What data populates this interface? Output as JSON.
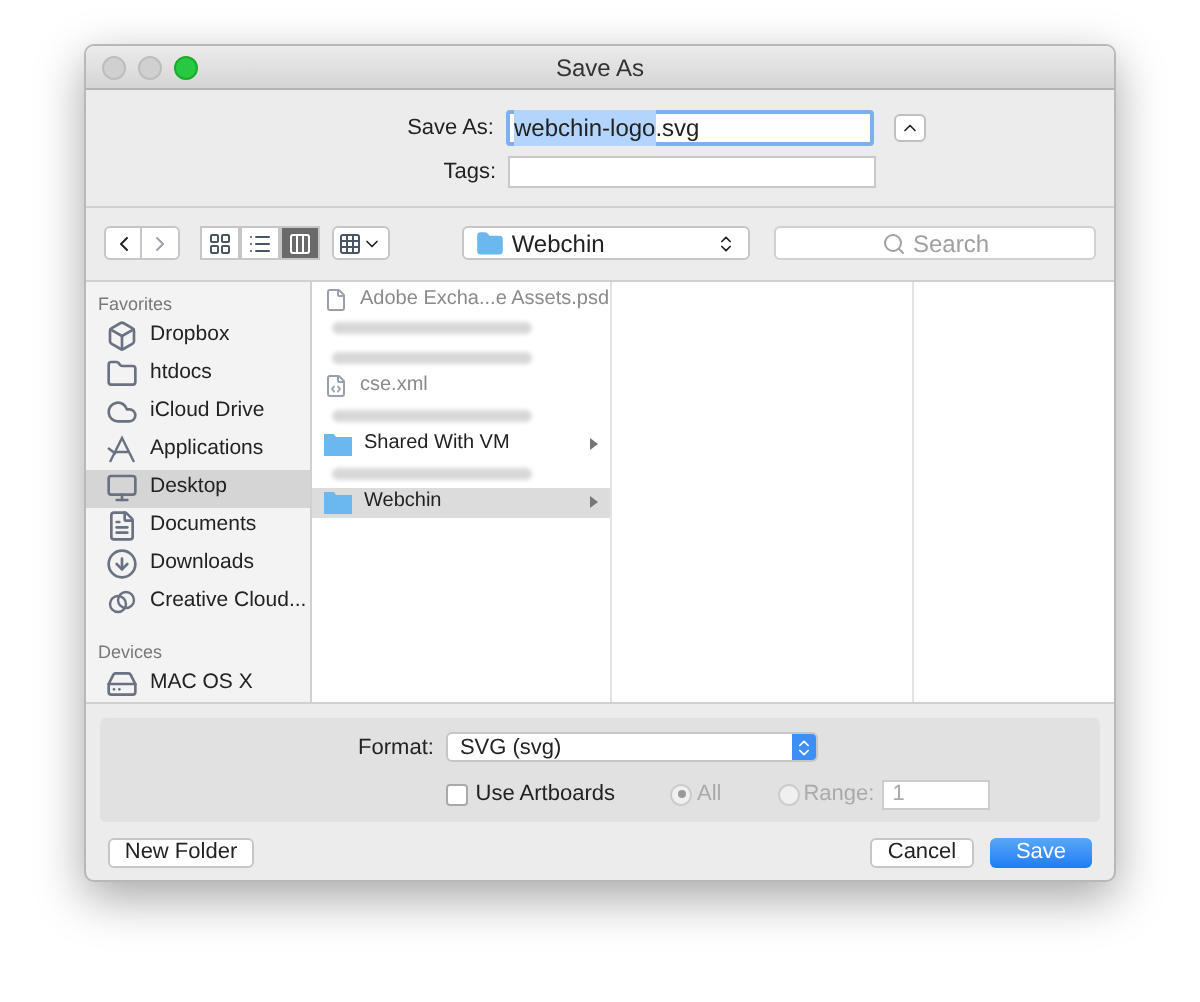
{
  "window": {
    "title": "Save As"
  },
  "save_as": {
    "label": "Save As:",
    "value": "webchin-logo",
    "extension": ".svg"
  },
  "tags": {
    "label": "Tags:"
  },
  "toolbar": {
    "location": "Webchin",
    "search_placeholder": "Search",
    "views": [
      {
        "kind": "icons",
        "selected": false
      },
      {
        "kind": "list",
        "selected": false
      },
      {
        "kind": "columns",
        "selected": true
      }
    ]
  },
  "sidebar": {
    "sections": [
      {
        "heading": "Favorites",
        "items": [
          {
            "label": "Dropbox",
            "kind": "dropbox",
            "selected": false
          },
          {
            "label": "htdocs",
            "kind": "folder",
            "selected": false
          },
          {
            "label": "iCloud Drive",
            "kind": "cloud",
            "selected": false
          },
          {
            "label": "Applications",
            "kind": "apps",
            "selected": false
          },
          {
            "label": "Desktop",
            "kind": "desktop",
            "selected": true
          },
          {
            "label": "Documents",
            "kind": "documents",
            "selected": false
          },
          {
            "label": "Downloads",
            "kind": "downloads",
            "selected": false
          },
          {
            "label": "Creative Cloud...",
            "kind": "creative",
            "selected": false
          }
        ]
      },
      {
        "heading": "Devices",
        "items": [
          {
            "label": "MAC OS X",
            "kind": "disk",
            "selected": false
          }
        ]
      }
    ]
  },
  "files": [
    {
      "kind": "psd",
      "name": "Adobe Excha...e Assets.psd",
      "dimmed": true,
      "selected": false
    },
    {
      "kind": "blurred",
      "selected": false
    },
    {
      "kind": "blurred",
      "selected": false
    },
    {
      "kind": "xml",
      "name": "cse.xml",
      "dimmed": true,
      "selected": false
    },
    {
      "kind": "blurred",
      "selected": false
    },
    {
      "kind": "folder",
      "name": "Shared With VM",
      "dimmed": false,
      "selected": false
    },
    {
      "kind": "blurred",
      "selected": false
    },
    {
      "kind": "folder",
      "name": "Webchin",
      "dimmed": false,
      "selected": true
    }
  ],
  "options": {
    "format_label": "Format:",
    "format": "SVG (svg)",
    "use_artboards": {
      "label": "Use Artboards",
      "checked": false
    },
    "all": {
      "label": "All",
      "selected": true,
      "disabled": true
    },
    "range": {
      "label": "Range:",
      "selected": false,
      "disabled": true,
      "value": "1"
    }
  },
  "buttons": {
    "new_folder": "New Folder",
    "cancel": "Cancel",
    "save": "Save"
  }
}
